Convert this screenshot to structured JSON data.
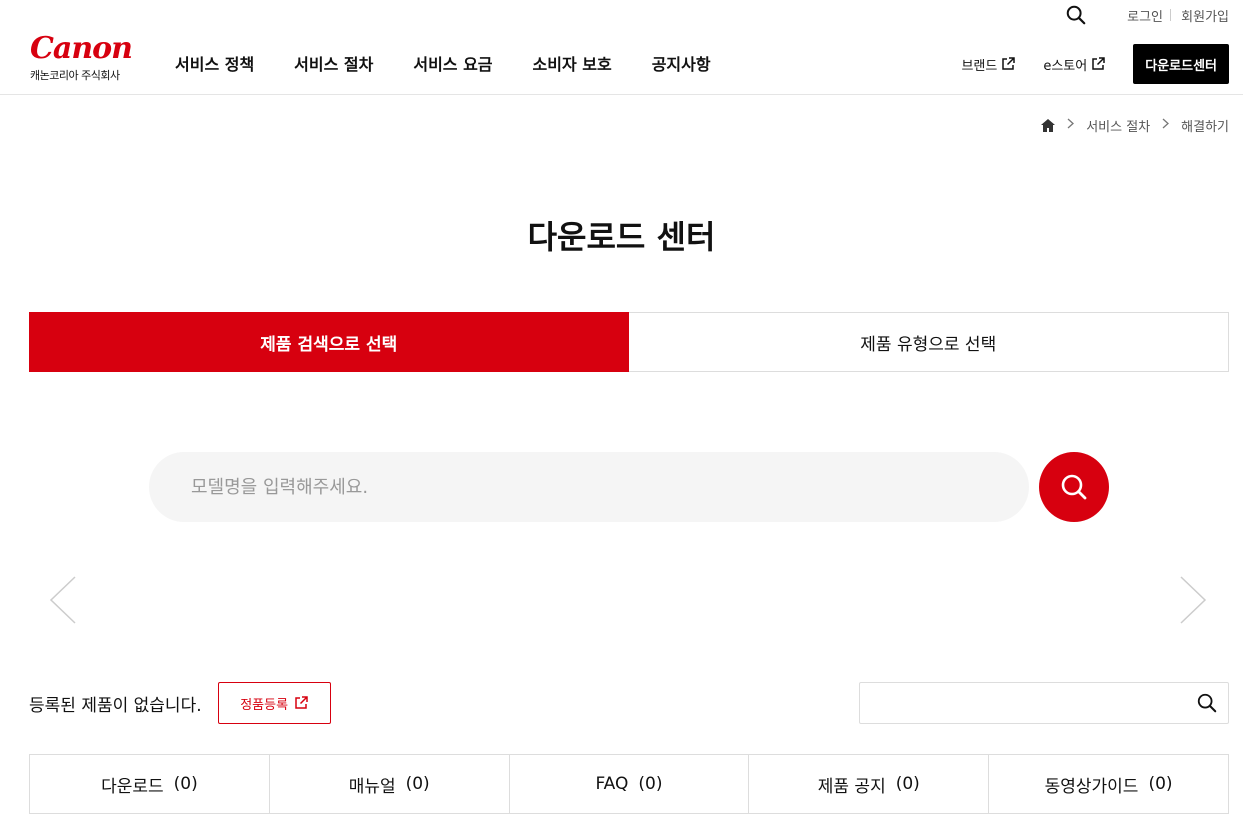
{
  "utility": {
    "login": "로그인",
    "join": "회원가입"
  },
  "logo": {
    "wordmark": "Canon",
    "subtitle": "캐논코리아 주식회사"
  },
  "gnb": {
    "menu": [
      "서비스 정책",
      "서비스 절차",
      "서비스 요금",
      "소비자 보호",
      "공지사항"
    ],
    "brand_link": "브랜드",
    "estore_link": "e스토어",
    "download_center_button": "다운로드센터"
  },
  "breadcrumb": {
    "items": [
      "서비스 절차",
      "해결하기"
    ]
  },
  "page_title": "다운로드 센터",
  "select_tabs": {
    "active": "제품 검색으로 선택",
    "inactive": "제품 유형으로 선택"
  },
  "search": {
    "placeholder": "모델명을 입력해주세요."
  },
  "registration": {
    "message": "등록된 제품이 없습니다.",
    "button": "정품등록"
  },
  "content_tabs": [
    {
      "label": "다운로드",
      "count": "(0)"
    },
    {
      "label": "매뉴얼",
      "count": "(0)"
    },
    {
      "label": "FAQ",
      "count": "(0)"
    },
    {
      "label": "제품 공지",
      "count": "(0)"
    },
    {
      "label": "동영상가이드",
      "count": "(0)"
    }
  ],
  "colors": {
    "brand_red": "#d7000f",
    "black": "#000000",
    "search_bg": "#f5f5f5",
    "border": "#dddddd"
  },
  "icons": [
    "search-icon",
    "external-link-icon",
    "home-icon",
    "chevron-right-icon",
    "chevron-left-icon"
  ]
}
